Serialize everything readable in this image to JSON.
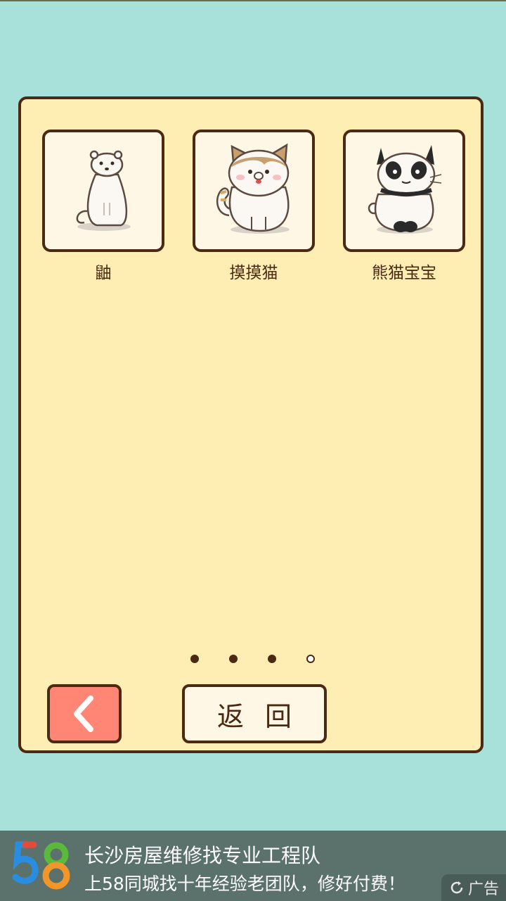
{
  "characters": [
    {
      "name": "鼬",
      "icon": "weasel-icon"
    },
    {
      "name": "摸摸猫",
      "icon": "tabby-cat-icon"
    },
    {
      "name": "熊猫宝宝",
      "icon": "panda-cat-icon"
    }
  ],
  "pagination": {
    "total": 4,
    "current": 4
  },
  "buttons": {
    "prev_icon": "chevron-left-icon",
    "back_label": "返回"
  },
  "ad": {
    "logo_text": "58",
    "title": "长沙房屋维修找专业工程队",
    "subtitle": "上58同城找十年经验老团队，修好付费！",
    "tag": "广告"
  },
  "colors": {
    "background": "#a8e0da",
    "panel": "#ffeeb3",
    "border": "#4a2a12",
    "prev_button": "#ff8574",
    "ad_bar": "#5b726c"
  }
}
